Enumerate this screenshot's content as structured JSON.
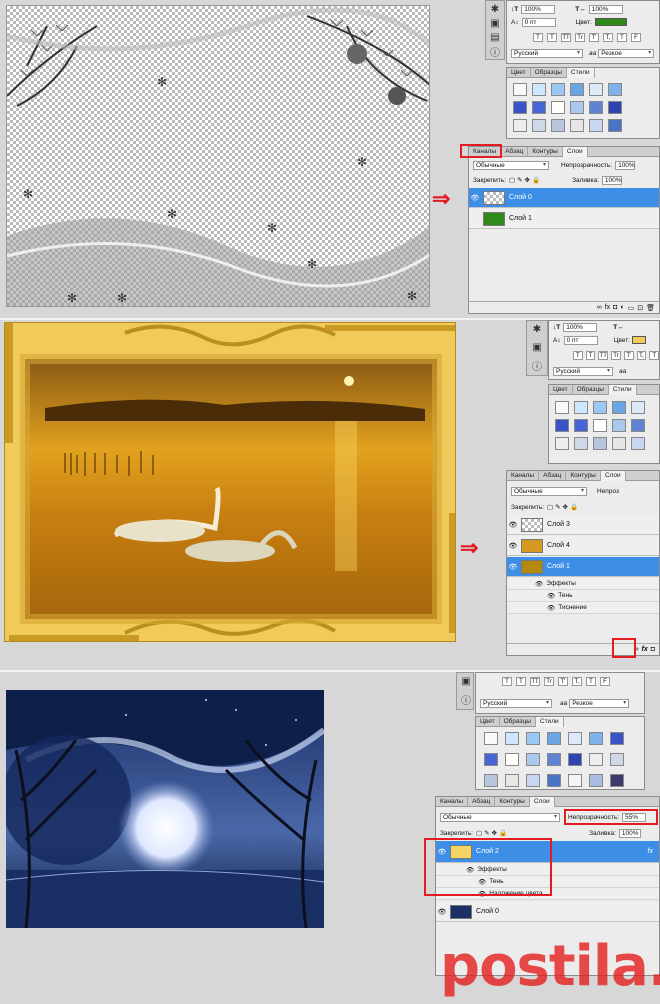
{
  "colors": {
    "accent": "#3d8ee6",
    "highlight": "#e31b23",
    "bg": "#d7d7d7",
    "panel": "#ececec"
  },
  "char_panel": {
    "size": "100%",
    "tracking": "0 пт",
    "color_label": "Цвет:",
    "style_buttons": [
      "T",
      "T",
      "TT",
      "Tr",
      "T'",
      "T,",
      "T",
      "F"
    ],
    "language": "Русский",
    "aa_icon": "aa",
    "aa_mode": "Резкое"
  },
  "styles_panel": {
    "tabs": [
      "Цвет",
      "Образцы",
      "Стили"
    ]
  },
  "layers_panel": {
    "tabs": [
      "Каналы",
      "Абзац",
      "Контуры",
      "Слои"
    ],
    "blend_mode": "Обычные",
    "opacity_label": "Непрозрачность:",
    "lock_label": "Закрепить:",
    "fill_label": "Заливка:",
    "footer_icons": [
      "∞",
      "fx",
      "◘",
      "◐",
      "▭",
      "⊡",
      "🗑"
    ]
  },
  "section1": {
    "opacity": "100%",
    "fill": "100%",
    "layers": [
      {
        "name": "Слой 0",
        "selected": true
      },
      {
        "name": "Слой 1",
        "selected": false
      }
    ]
  },
  "section2": {
    "opacity": "Непроз",
    "layers": [
      {
        "name": "Слой 3"
      },
      {
        "name": "Слой 4"
      },
      {
        "name": "Слой 1",
        "selected": true
      }
    ],
    "effects_label": "Эффекты",
    "effects": [
      "Тень",
      "Тиснение"
    ]
  },
  "section3": {
    "opacity": "55%",
    "fill": "100%",
    "layers": [
      {
        "name": "Слой 2",
        "selected": true
      },
      {
        "name": "Слой 0"
      }
    ],
    "effects_label": "Эффекты",
    "effects": [
      "Тень",
      "Наложение цвета"
    ]
  },
  "watermark": "postila.ru"
}
